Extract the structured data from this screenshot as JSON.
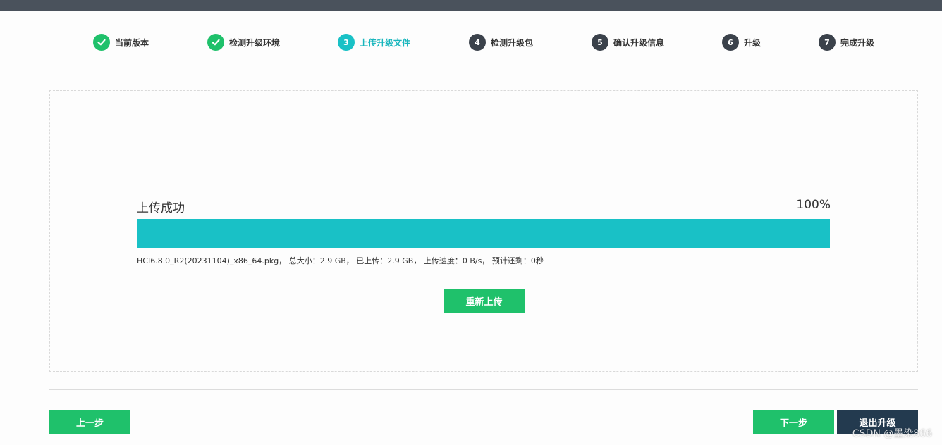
{
  "stepper": {
    "steps": [
      {
        "num": "1",
        "label": "当前版本",
        "state": "done"
      },
      {
        "num": "2",
        "label": "检测升级环境",
        "state": "done"
      },
      {
        "num": "3",
        "label": "上传升级文件",
        "state": "active"
      },
      {
        "num": "4",
        "label": "检测升级包",
        "state": "pending"
      },
      {
        "num": "5",
        "label": "确认升级信息",
        "state": "pending"
      },
      {
        "num": "6",
        "label": "升级",
        "state": "pending"
      },
      {
        "num": "7",
        "label": "完成升级",
        "state": "pending"
      }
    ]
  },
  "upload": {
    "status": "上传成功",
    "percent_label": "100%",
    "progress": 1.0,
    "file_info": "HCI6.8.0_R2(20231104)_x86_64.pkg，  总大小：2.9 GB，  已上传：2.9 GB，  上传速度：0 B/s，  预计还剩：0秒",
    "reupload_label": "重新上传"
  },
  "footer": {
    "prev_label": "上一步",
    "next_label": "下一步",
    "exit_label": "退出升级"
  },
  "watermark": "CSDN @墨染866",
  "colors": {
    "done": "#1fc16b",
    "active": "#19c1c6",
    "pending": "#3b424b",
    "progress": "#19c1c6",
    "exit": "#233a4f"
  }
}
